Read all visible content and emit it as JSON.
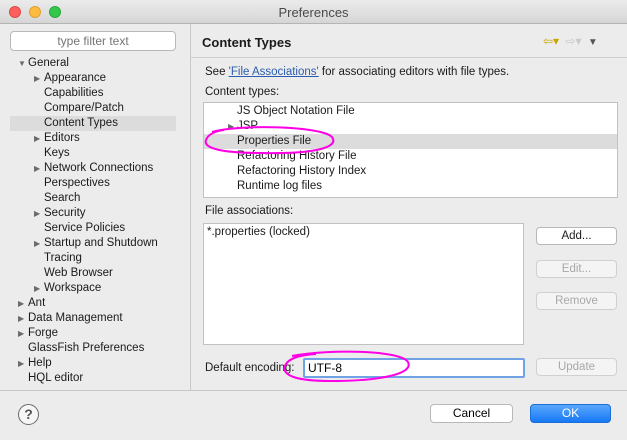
{
  "window": {
    "title": "Preferences"
  },
  "filter": {
    "placeholder": "type filter text"
  },
  "tree": {
    "items": [
      {
        "label": "General",
        "arrow": "▼"
      },
      {
        "label": "Appearance",
        "arrow": "▶"
      },
      {
        "label": "Capabilities",
        "arrow": ""
      },
      {
        "label": "Compare/Patch",
        "arrow": ""
      },
      {
        "label": "Content Types",
        "arrow": ""
      },
      {
        "label": "Editors",
        "arrow": "▶"
      },
      {
        "label": "Keys",
        "arrow": ""
      },
      {
        "label": "Network Connections",
        "arrow": "▶"
      },
      {
        "label": "Perspectives",
        "arrow": ""
      },
      {
        "label": "Search",
        "arrow": ""
      },
      {
        "label": "Security",
        "arrow": "▶"
      },
      {
        "label": "Service Policies",
        "arrow": ""
      },
      {
        "label": "Startup and Shutdown",
        "arrow": "▶"
      },
      {
        "label": "Tracing",
        "arrow": ""
      },
      {
        "label": "Web Browser",
        "arrow": ""
      },
      {
        "label": "Workspace",
        "arrow": "▶"
      },
      {
        "label": "Ant",
        "arrow": "▶"
      },
      {
        "label": "Data Management",
        "arrow": "▶"
      },
      {
        "label": "Forge",
        "arrow": "▶"
      },
      {
        "label": "GlassFish Preferences",
        "arrow": ""
      },
      {
        "label": "Help",
        "arrow": "▶"
      },
      {
        "label": "HQL editor",
        "arrow": ""
      }
    ]
  },
  "page": {
    "title": "Content Types",
    "see_prefix": "See",
    "see_link": "'File Associations'",
    "see_suffix": "for associating editors with file types.",
    "content_types_label": "Content types:",
    "content_types": [
      {
        "label": "JS Object Notation File",
        "arrow": ""
      },
      {
        "label": "JSP",
        "arrow": "▶"
      },
      {
        "label": "Properties File",
        "arrow": ""
      },
      {
        "label": "Refactoring History File",
        "arrow": ""
      },
      {
        "label": "Refactoring History Index",
        "arrow": ""
      },
      {
        "label": "Runtime log files",
        "arrow": ""
      }
    ],
    "file_assoc_label": "File associations:",
    "file_assoc": [
      "*.properties (locked)"
    ],
    "buttons": {
      "add": "Add...",
      "edit": "Edit...",
      "remove": "Remove",
      "update": "Update"
    },
    "encoding_label": "Default encoding:",
    "encoding_value": "UTF-8"
  },
  "footer": {
    "help": "?",
    "cancel": "Cancel",
    "ok": "OK"
  },
  "colors": {
    "highlight": "#ff00e6",
    "accent": "#1678f5"
  }
}
